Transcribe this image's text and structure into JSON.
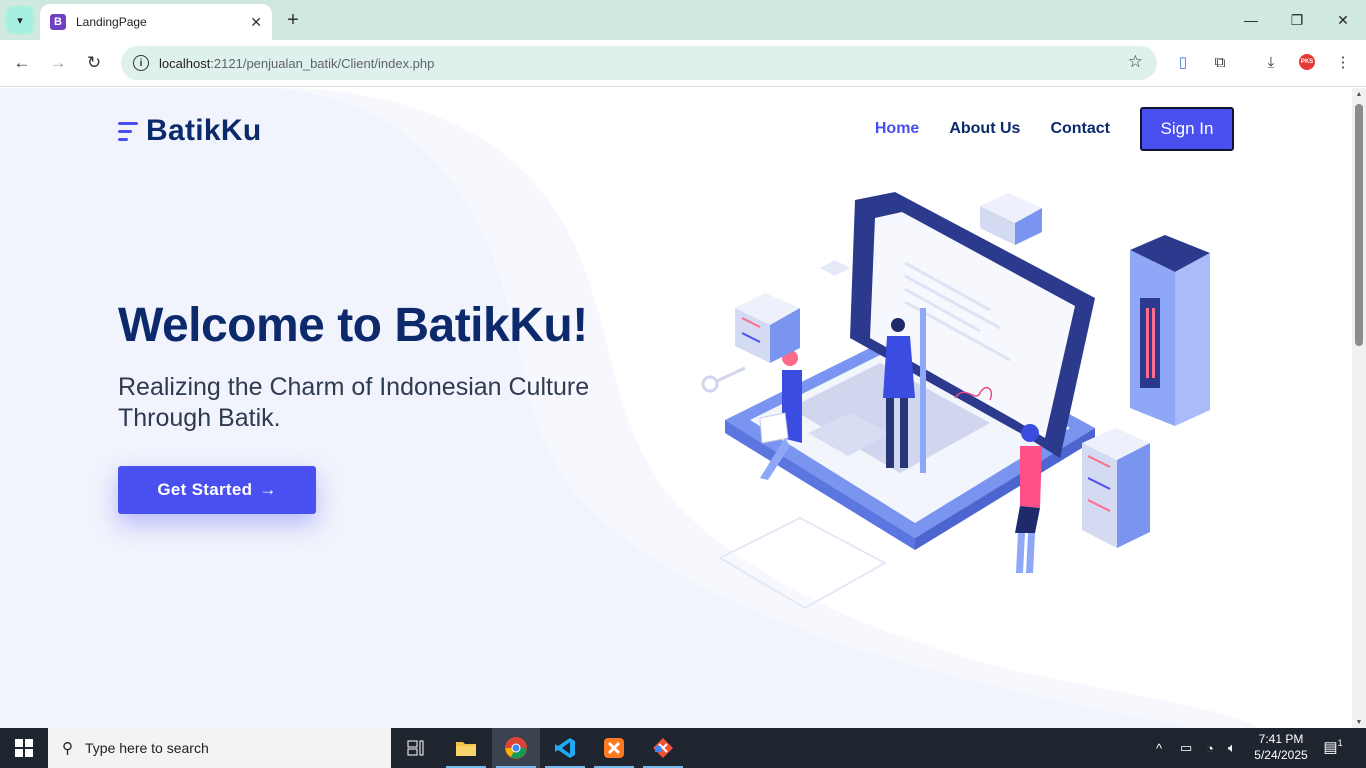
{
  "browser": {
    "tab_title": "LandingPage",
    "tab_favicon_letter": "B",
    "url_host": "localhost",
    "url_path": ":2121/penjualan_batik/Client/index.php",
    "profile_badge": "PKS"
  },
  "site": {
    "brand": "BatikKu",
    "nav": [
      {
        "label": "Home",
        "active": true
      },
      {
        "label": "About Us",
        "active": false
      },
      {
        "label": "Contact",
        "active": false
      }
    ],
    "signin_label": "Sign In",
    "hero_title": "Welcome to BatikKu!",
    "hero_subtitle": "Realizing the Charm of Indonesian Culture Through Batik.",
    "cta_label": "Get Started",
    "cta_arrow": "→",
    "accent_color": "#4a4ff0",
    "navy_color": "#0c2a6b"
  },
  "taskbar": {
    "search_placeholder": "Type here to search",
    "time": "7:41 PM",
    "date": "5/24/2025",
    "notification_count": "1"
  }
}
